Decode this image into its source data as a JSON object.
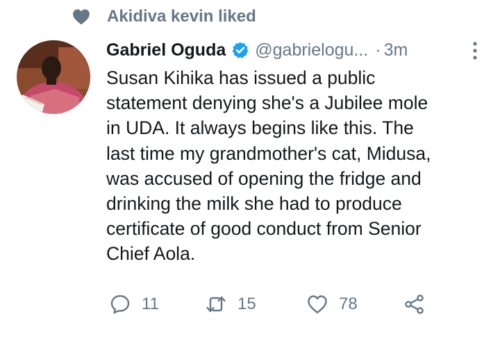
{
  "social_context": {
    "text": "Akidiva kevin liked",
    "icon": "heart-icon"
  },
  "tweet": {
    "author_name": "Gabriel Oguda",
    "verified": true,
    "handle": "@gabrielogu...",
    "separator": "·",
    "time": "3m",
    "text": "Susan Kihika has issued a public\nstatement denying she's a Jubilee mole\nin UDA. It always begins like this. The\nlast time my grandmother's cat, Midusa,\nwas accused of opening the fridge and\ndrinking the milk she had to produce\ncertificate of good conduct from Senior\nChief Aola.",
    "replies": "11",
    "retweets": "15",
    "likes": "78"
  },
  "colors": {
    "secondary": "#657786",
    "verified": "#1da1f2",
    "text": "#14171a"
  }
}
